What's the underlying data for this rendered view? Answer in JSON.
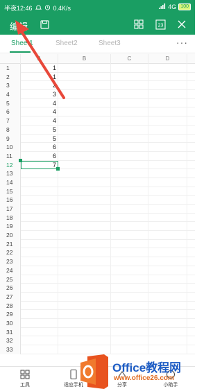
{
  "status": {
    "time": "半夜12:46",
    "speed": "0.4K/s",
    "network": "4G",
    "battery": "100"
  },
  "toolbar": {
    "edit_label": "编辑"
  },
  "tabs": [
    {
      "label": "Sheet1"
    },
    {
      "label": "Sheet2"
    },
    {
      "label": "Sheet3"
    }
  ],
  "more_label": "···",
  "columns": [
    "A",
    "B",
    "C",
    "D"
  ],
  "rows": [
    {
      "n": "1",
      "a": "1"
    },
    {
      "n": "2",
      "a": "1"
    },
    {
      "n": "3",
      "a": "2"
    },
    {
      "n": "4",
      "a": "3"
    },
    {
      "n": "5",
      "a": "4"
    },
    {
      "n": "6",
      "a": "4"
    },
    {
      "n": "7",
      "a": "4"
    },
    {
      "n": "8",
      "a": "5"
    },
    {
      "n": "9",
      "a": "5"
    },
    {
      "n": "10",
      "a": "6"
    },
    {
      "n": "11",
      "a": "6"
    },
    {
      "n": "12",
      "a": "7"
    },
    {
      "n": "13",
      "a": ""
    },
    {
      "n": "14",
      "a": ""
    },
    {
      "n": "15",
      "a": ""
    },
    {
      "n": "16",
      "a": ""
    },
    {
      "n": "17",
      "a": ""
    },
    {
      "n": "18",
      "a": ""
    },
    {
      "n": "19",
      "a": ""
    },
    {
      "n": "20",
      "a": ""
    },
    {
      "n": "21",
      "a": ""
    },
    {
      "n": "22",
      "a": ""
    },
    {
      "n": "23",
      "a": ""
    },
    {
      "n": "24",
      "a": ""
    },
    {
      "n": "25",
      "a": ""
    },
    {
      "n": "26",
      "a": ""
    },
    {
      "n": "27",
      "a": ""
    },
    {
      "n": "28",
      "a": ""
    },
    {
      "n": "29",
      "a": ""
    },
    {
      "n": "30",
      "a": ""
    },
    {
      "n": "31",
      "a": ""
    },
    {
      "n": "32",
      "a": ""
    },
    {
      "n": "33",
      "a": ""
    }
  ],
  "selected_row": "12",
  "bottom": {
    "tools": "工具",
    "fit_phone": "适应手机",
    "share": "分享",
    "assistant": "小助手"
  },
  "watermark": {
    "title": "Office教程网",
    "url": "www.office26.com"
  },
  "colors": {
    "accent": "#1a9e63",
    "annotation": "#e8483a"
  }
}
